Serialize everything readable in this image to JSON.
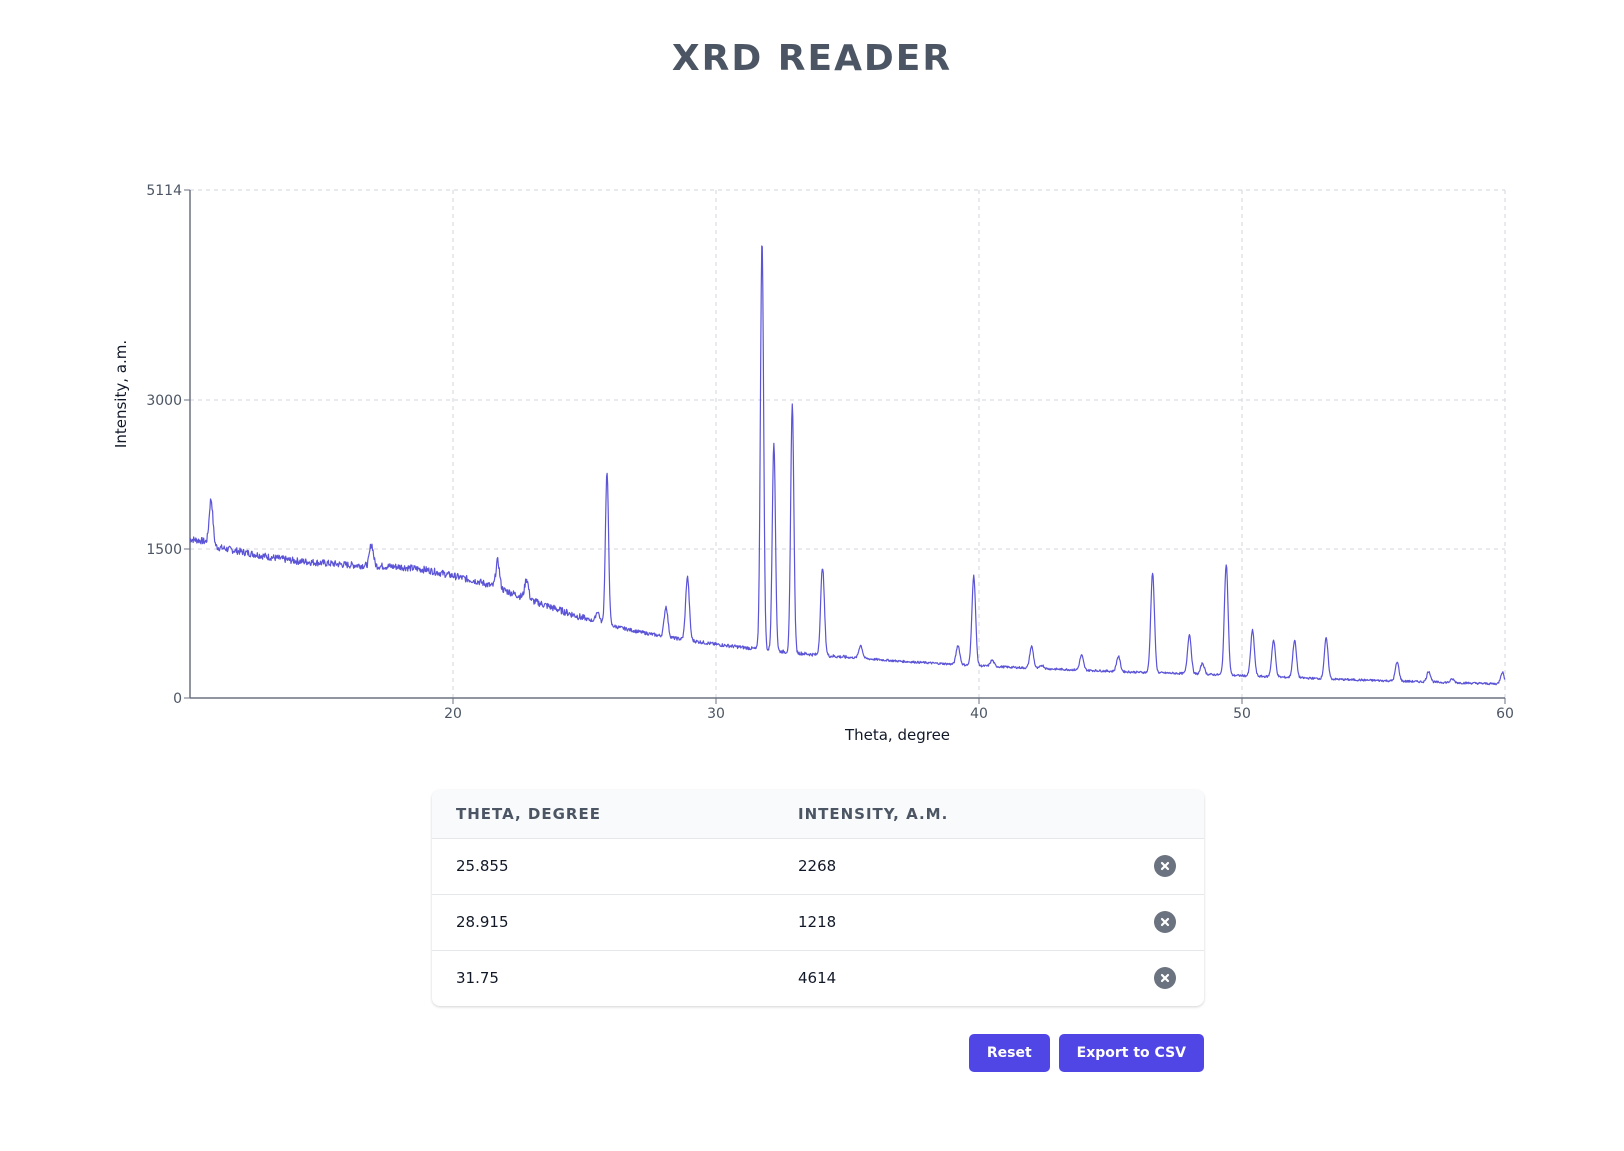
{
  "app": {
    "title": "XRD READER"
  },
  "chart_data": {
    "type": "line",
    "xlabel": "Theta, degree",
    "ylabel": "Intensity, a.m.",
    "xlim": [
      10,
      60
    ],
    "ylim": [
      0,
      5114
    ],
    "xticks": [
      20,
      30,
      40,
      50,
      60
    ],
    "yticks": [
      0,
      1500,
      3000,
      5114
    ],
    "grid": true,
    "line_color": "#5b54d6",
    "background_points": [
      [
        10,
        1600
      ],
      [
        10.5,
        1580
      ],
      [
        11,
        1520
      ],
      [
        12,
        1470
      ],
      [
        13,
        1420
      ],
      [
        14,
        1380
      ],
      [
        15,
        1360
      ],
      [
        16,
        1340
      ],
      [
        17,
        1330
      ],
      [
        18,
        1320
      ],
      [
        19,
        1290
      ],
      [
        20,
        1230
      ],
      [
        21,
        1170
      ],
      [
        22,
        1080
      ],
      [
        23,
        980
      ],
      [
        24,
        890
      ],
      [
        25,
        800
      ],
      [
        26,
        730
      ],
      [
        27,
        670
      ],
      [
        28,
        620
      ],
      [
        29,
        580
      ],
      [
        30,
        540
      ],
      [
        31,
        510
      ],
      [
        32,
        480
      ],
      [
        33,
        455
      ],
      [
        34,
        430
      ],
      [
        35,
        410
      ],
      [
        36,
        390
      ],
      [
        37,
        370
      ],
      [
        38,
        355
      ],
      [
        39,
        340
      ],
      [
        40,
        325
      ],
      [
        42,
        300
      ],
      [
        44,
        280
      ],
      [
        46,
        260
      ],
      [
        48,
        245
      ],
      [
        50,
        225
      ],
      [
        52,
        205
      ],
      [
        54,
        185
      ],
      [
        56,
        170
      ],
      [
        58,
        155
      ],
      [
        60,
        140
      ]
    ],
    "peaks": [
      {
        "theta": 10.8,
        "intensity": 2000
      },
      {
        "theta": 16.9,
        "intensity": 1550
      },
      {
        "theta": 21.7,
        "intensity": 1380
      },
      {
        "theta": 22.8,
        "intensity": 1200
      },
      {
        "theta": 25.5,
        "intensity": 870
      },
      {
        "theta": 25.855,
        "intensity": 2268
      },
      {
        "theta": 28.1,
        "intensity": 920
      },
      {
        "theta": 28.915,
        "intensity": 1218
      },
      {
        "theta": 31.75,
        "intensity": 4614
      },
      {
        "theta": 32.2,
        "intensity": 2580
      },
      {
        "theta": 32.9,
        "intensity": 2960
      },
      {
        "theta": 34.05,
        "intensity": 1320
      },
      {
        "theta": 35.5,
        "intensity": 530
      },
      {
        "theta": 39.2,
        "intensity": 530
      },
      {
        "theta": 39.8,
        "intensity": 1230
      },
      {
        "theta": 40.5,
        "intensity": 380
      },
      {
        "theta": 42.0,
        "intensity": 520
      },
      {
        "theta": 42.4,
        "intensity": 330
      },
      {
        "theta": 43.9,
        "intensity": 430
      },
      {
        "theta": 45.3,
        "intensity": 420
      },
      {
        "theta": 46.6,
        "intensity": 1260
      },
      {
        "theta": 48.0,
        "intensity": 640
      },
      {
        "theta": 48.5,
        "intensity": 350
      },
      {
        "theta": 49.4,
        "intensity": 1350
      },
      {
        "theta": 50.4,
        "intensity": 680
      },
      {
        "theta": 51.2,
        "intensity": 580
      },
      {
        "theta": 52.0,
        "intensity": 580
      },
      {
        "theta": 53.2,
        "intensity": 600
      },
      {
        "theta": 55.9,
        "intensity": 360
      },
      {
        "theta": 57.1,
        "intensity": 270
      },
      {
        "theta": 58.0,
        "intensity": 190
      },
      {
        "theta": 59.9,
        "intensity": 260
      }
    ]
  },
  "table": {
    "headers": [
      "Theta, degree",
      "Intensity, a.m."
    ],
    "rows": [
      {
        "theta": "25.855",
        "intensity": "2268",
        "remove_icon": "close-circle-icon"
      },
      {
        "theta": "28.915",
        "intensity": "1218",
        "remove_icon": "close-circle-icon"
      },
      {
        "theta": "31.75",
        "intensity": "4614",
        "remove_icon": "close-circle-icon"
      }
    ]
  },
  "actions": {
    "reset_label": "Reset",
    "export_label": "Export to CSV"
  },
  "colors": {
    "accent": "#4f46e5",
    "title": "#4b5563",
    "remove_icon": "#6b7280"
  }
}
